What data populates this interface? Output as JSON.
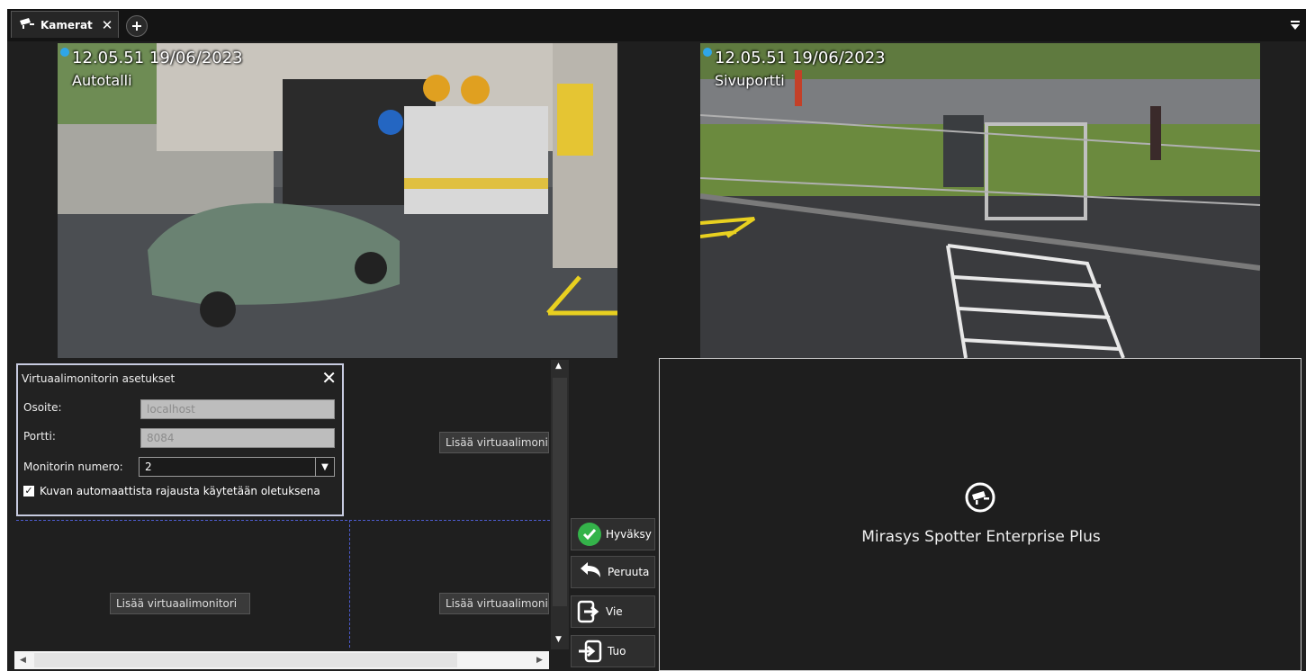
{
  "tabs": [
    {
      "label": "Kamerat",
      "icon": "camera-icon",
      "active": true
    }
  ],
  "cameras": [
    {
      "timestamp": "12.05.51  19/06/2023",
      "name": "Autotalli"
    },
    {
      "timestamp": "12.05.51  19/06/2023",
      "name": "Sivuportti"
    }
  ],
  "settings_panel": {
    "title": "Virtuaalimonitorin asetukset",
    "address_label": "Osoite:",
    "address_placeholder": "localhost",
    "port_label": "Portti:",
    "port_placeholder": "8084",
    "monitor_number_label": "Monitorin numero:",
    "monitor_number_value": "2",
    "auto_crop_label": "Kuvan automaattista rajausta käytetään oletuksena",
    "auto_crop_checked": true
  },
  "grid": {
    "add_label": "Lisää virtuaalimonitori"
  },
  "actions": {
    "accept": "Hyväksy",
    "cancel": "Peruuta",
    "export": "Vie",
    "import": "Tuo"
  },
  "monitor": {
    "product_name": "Mirasys Spotter Enterprise Plus",
    "icon": "camera-icon"
  },
  "colors": {
    "background": "#1f1f1f",
    "accent_dashed": "#4d5ccf",
    "accept_green": "#34b34a",
    "status_dot": "#2fa6e8"
  }
}
